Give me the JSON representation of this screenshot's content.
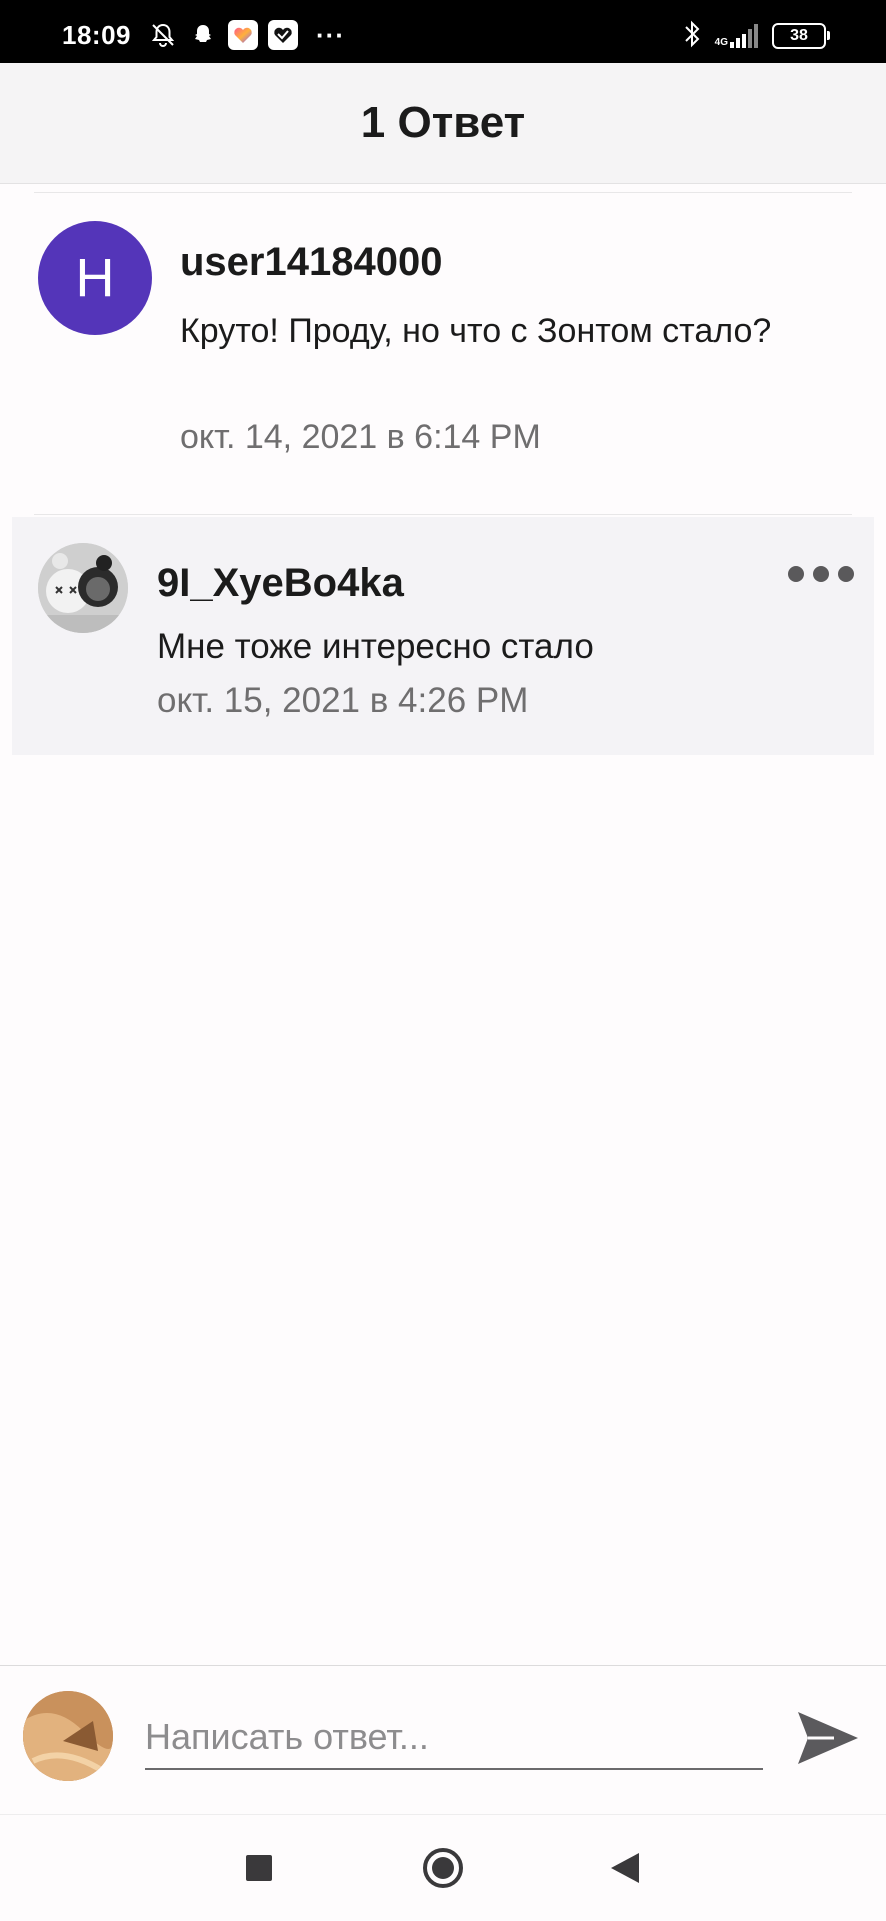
{
  "status_bar": {
    "time": "18:09",
    "battery": "38",
    "network": "4G",
    "overflow": "···",
    "left_icons": [
      "bell-off-icon",
      "snapchat-icon",
      "heart-app-icon",
      "heart-app-2-icon"
    ],
    "right_icons": [
      "bluetooth-icon",
      "signal-icon",
      "battery-icon"
    ]
  },
  "header": {
    "title": "1 Ответ"
  },
  "comment": {
    "avatar_letter": "H",
    "avatar_color": "#5435b9",
    "username": "user14184000",
    "text": "Круто! Проду, но что с Зонтом стало?",
    "date": "окт. 14, 2021 в 6:14 PM"
  },
  "reply": {
    "username": "9I_XyeBo4ka",
    "text": "Мне тоже интересно стало",
    "date": "окт. 15, 2021 в 4:26 PM",
    "more_icon": "more-horizontal-icon"
  },
  "composer": {
    "placeholder": "Написать ответ...",
    "value": "",
    "send_icon": "send-icon"
  },
  "nav": {
    "icons": [
      "recents-square-icon",
      "home-circle-icon",
      "back-triangle-icon"
    ]
  }
}
